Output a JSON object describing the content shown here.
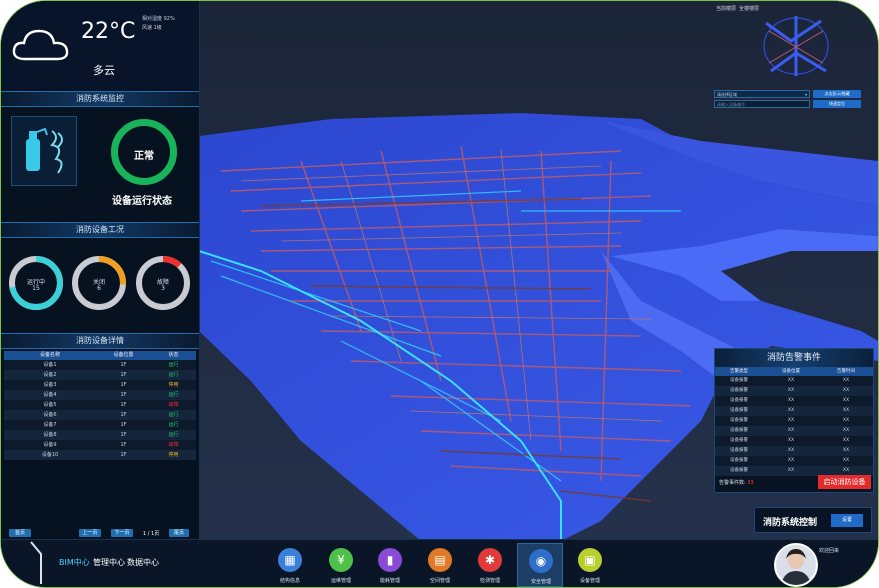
{
  "weather": {
    "temperature": "22°C",
    "description": "多云",
    "humidity": "相对湿度 92%",
    "wind": "风速 1级"
  },
  "fire_monitor": {
    "title": "消防系统监控",
    "status_value": "正常",
    "status_label": "设备运行状态"
  },
  "equipment_status": {
    "title": "消防设备工况",
    "gauges": [
      {
        "label": "运行中",
        "value": "15",
        "fraction": 0.72,
        "color": "#3ad0d8"
      },
      {
        "label": "关闭",
        "value": "6",
        "fraction": 0.26,
        "color": "#f0a020"
      },
      {
        "label": "故障",
        "value": "3",
        "fraction": 0.12,
        "color": "#f03030"
      }
    ]
  },
  "details": {
    "title": "消防设备详情",
    "headers": [
      "设备名称",
      "设备位置",
      "状态"
    ],
    "rows": [
      {
        "name": "设备1",
        "location": "1F",
        "status": "运行",
        "color": "#27d06a"
      },
      {
        "name": "设备2",
        "location": "1F",
        "status": "运行",
        "color": "#27d06a"
      },
      {
        "name": "设备3",
        "location": "1F",
        "status": "停用",
        "color": "#f0b020"
      },
      {
        "name": "设备4",
        "location": "1F",
        "status": "运行",
        "color": "#27d06a"
      },
      {
        "name": "设备5",
        "location": "1F",
        "status": "故障",
        "color": "#f03030"
      },
      {
        "name": "设备6",
        "location": "1F",
        "status": "运行",
        "color": "#27d06a"
      },
      {
        "name": "设备7",
        "location": "1F",
        "status": "运行",
        "color": "#27d06a"
      },
      {
        "name": "设备8",
        "location": "1F",
        "status": "运行",
        "color": "#27d06a"
      },
      {
        "name": "设备9",
        "location": "1F",
        "status": "故障",
        "color": "#f03030"
      },
      {
        "name": "设备10",
        "location": "1F",
        "status": "停用",
        "color": "#f0b020"
      }
    ],
    "pager": {
      "first": "首页",
      "prev": "上一页",
      "next": "下一页",
      "page": "1 / 1页",
      "last": "尾页"
    }
  },
  "top_links": [
    "当前楼层",
    "全楼楼层"
  ],
  "layer_select": {
    "value": "请选择区域",
    "placeholder": "请输入设备编号",
    "btn_show": "点击显示/隐藏",
    "btn_locate": "快速定位"
  },
  "alarm": {
    "title": "消防告警事件",
    "headers": [
      "告警类型",
      "设备位置",
      "告警时间"
    ],
    "rows": [
      [
        "设备报警",
        "XX",
        "XX"
      ],
      [
        "设备报警",
        "XX",
        "XX"
      ],
      [
        "设备报警",
        "XX",
        "XX"
      ],
      [
        "设备报警",
        "XX",
        "XX"
      ],
      [
        "设备报警",
        "XX",
        "XX"
      ],
      [
        "设备报警",
        "XX",
        "XX"
      ],
      [
        "设备报警",
        "XX",
        "XX"
      ],
      [
        "设备报警",
        "XX",
        "XX"
      ],
      [
        "设备报警",
        "XX",
        "XX"
      ],
      [
        "设备报警",
        "XX",
        "XX"
      ]
    ],
    "count_label": "告警事件数:",
    "count_value": "33",
    "action_button": "启动消防设备"
  },
  "control": {
    "title": "消防系统控制",
    "button": "设置"
  },
  "bottom_nav": [
    "BIM中心",
    "管理中心",
    "数据中心"
  ],
  "tools": [
    {
      "label": "结构信息",
      "color": "#3a7fd8",
      "glyph": "▦"
    },
    {
      "label": "运维管理",
      "color": "#4fc04a",
      "glyph": "¥"
    },
    {
      "label": "能耗管理",
      "color": "#8a4ad8",
      "glyph": "▮"
    },
    {
      "label": "空间管理",
      "color": "#e07a28",
      "glyph": "▤"
    },
    {
      "label": "检测管理",
      "color": "#e03a3a",
      "glyph": "✱"
    },
    {
      "label": "安全管理",
      "color": "#2e6ec8",
      "glyph": "◉"
    },
    {
      "label": "设备管理",
      "color": "#b8d02e",
      "glyph": "▣"
    }
  ],
  "user": {
    "label": "欢迎回来"
  }
}
